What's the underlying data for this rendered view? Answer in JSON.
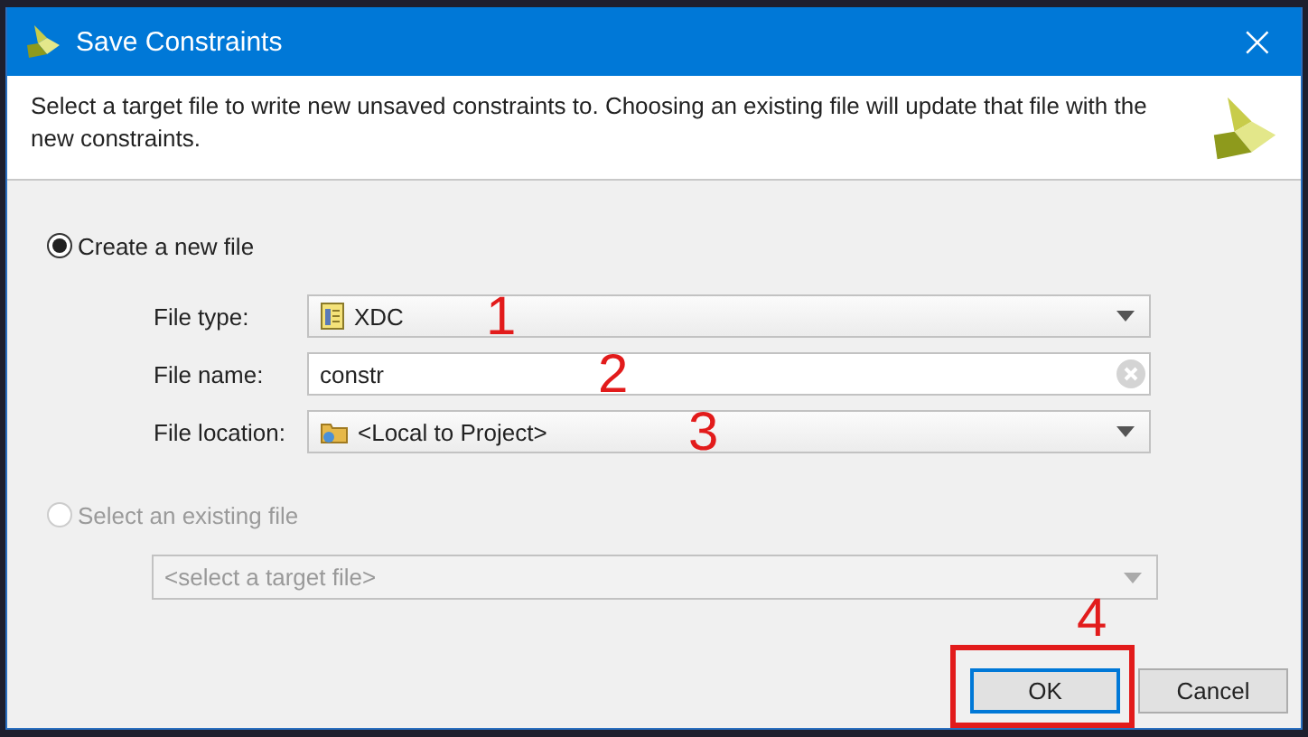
{
  "window": {
    "title": "Save Constraints",
    "close": "×"
  },
  "description": "Select a target file to write new unsaved constraints to. Choosing an existing file will update that file with the new constraints.",
  "options": [
    {
      "label": "Create a new file",
      "selected": true,
      "disabled": false
    },
    {
      "label": "Select an existing file",
      "selected": false,
      "disabled": true
    }
  ],
  "fields": [
    {
      "kind": "dropdown",
      "label": "File type:",
      "value": "XDC"
    },
    {
      "kind": "text",
      "label": "File name:",
      "value": "constr"
    },
    {
      "kind": "dropdown",
      "label": "File location:",
      "value": "<Local to Project>"
    }
  ],
  "target_file": {
    "placeholder": "<select a target file>",
    "disabled": true
  },
  "buttons": [
    {
      "label": "OK",
      "focused": true,
      "highlighted": true
    },
    {
      "label": "Cancel",
      "focused": false,
      "highlighted": false
    }
  ],
  "annotations": [
    {
      "label": "1"
    },
    {
      "label": "2"
    },
    {
      "label": "3"
    },
    {
      "label": "4"
    }
  ]
}
